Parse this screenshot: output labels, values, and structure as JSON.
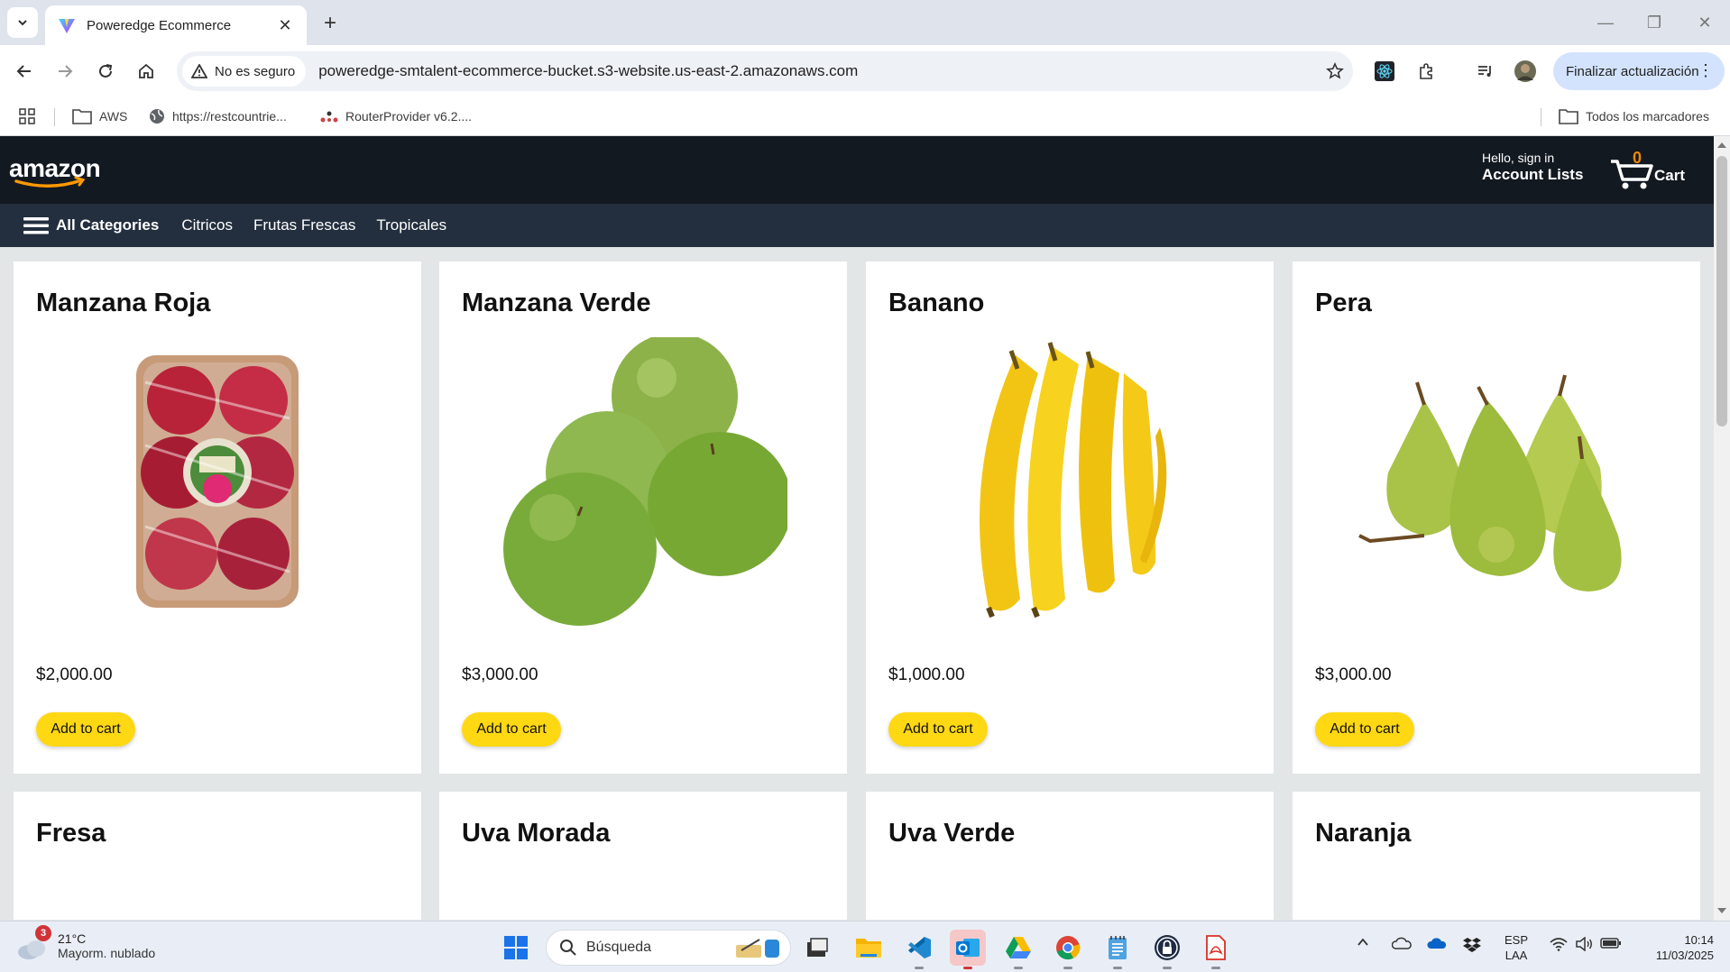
{
  "browser": {
    "tab_title": "Poweredge Ecommerce",
    "security_label": "No es seguro",
    "url": "poweredge-smtalent-ecommerce-bucket.s3-website.us-east-2.amazonaws.com",
    "update_button": "Finalizar actualización",
    "bookmarks": [
      {
        "label": "AWS",
        "icon": "folder-icon"
      },
      {
        "label": "https://restcountrie...",
        "icon": "globe-icon"
      },
      {
        "label": "RouterProvider v6.2....",
        "icon": "router-icon"
      }
    ],
    "all_bookmarks": "Todos los marcadores"
  },
  "header": {
    "logo": "amazon",
    "account_line1": "Hello, sign in",
    "account_line2": "Account Lists",
    "cart_count": "0",
    "cart_label": "Cart",
    "brand_color": "#131921",
    "nav_color": "#232f3e",
    "button_color": "#ffd814"
  },
  "nav": {
    "all_categories": "All Categories",
    "categories": [
      "Citricos",
      "Frutas Frescas",
      "Tropicales"
    ]
  },
  "products": [
    {
      "name": "Manzana Roja",
      "price": "$2,000.00",
      "button": "Add to cart",
      "image": "red-apples-package"
    },
    {
      "name": "Manzana Verde",
      "price": "$3,000.00",
      "button": "Add to cart",
      "image": "green-apples"
    },
    {
      "name": "Banano",
      "price": "$1,000.00",
      "button": "Add to cart",
      "image": "bananas"
    },
    {
      "name": "Pera",
      "price": "$3,000.00",
      "button": "Add to cart",
      "image": "pears"
    },
    {
      "name": "Fresa"
    },
    {
      "name": "Uva Morada"
    },
    {
      "name": "Uva Verde"
    },
    {
      "name": "Naranja"
    }
  ],
  "taskbar": {
    "weather_badge": "3",
    "temperature": "21°C",
    "weather_desc": "Mayorm. nublado",
    "search_placeholder": "Búsqueda",
    "lang1": "ESP",
    "lang2": "LAA",
    "time": "10:14",
    "date": "11/03/2025"
  }
}
